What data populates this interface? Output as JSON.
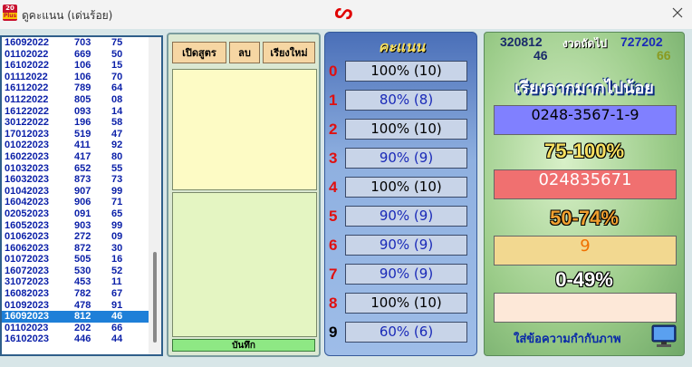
{
  "window": {
    "title": "ดูคะแนน (เด่นร้อย)",
    "app_icon_top": "20",
    "app_icon_bottom": "Plus"
  },
  "list": {
    "rows": [
      [
        "16092022",
        "703",
        "75"
      ],
      [
        "01102022",
        "669",
        "50"
      ],
      [
        "16102022",
        "106",
        "15"
      ],
      [
        "01112022",
        "106",
        "70"
      ],
      [
        "16112022",
        "789",
        "64"
      ],
      [
        "01122022",
        "805",
        "08"
      ],
      [
        "16122022",
        "093",
        "14"
      ],
      [
        "30122022",
        "196",
        "58"
      ],
      [
        "17012023",
        "519",
        "47"
      ],
      [
        "01022023",
        "411",
        "92"
      ],
      [
        "16022023",
        "417",
        "80"
      ],
      [
        "01032023",
        "652",
        "55"
      ],
      [
        "16032023",
        "873",
        "73"
      ],
      [
        "01042023",
        "907",
        "99"
      ],
      [
        "16042023",
        "906",
        "71"
      ],
      [
        "02052023",
        "091",
        "65"
      ],
      [
        "16052023",
        "903",
        "99"
      ],
      [
        "01062023",
        "272",
        "09"
      ],
      [
        "16062023",
        "872",
        "30"
      ],
      [
        "01072023",
        "505",
        "16"
      ],
      [
        "16072023",
        "530",
        "52"
      ],
      [
        "31072023",
        "453",
        "11"
      ],
      [
        "16082023",
        "782",
        "67"
      ],
      [
        "01092023",
        "478",
        "91"
      ],
      [
        "16092023",
        "812",
        "46"
      ],
      [
        "01102023",
        "202",
        "66"
      ],
      [
        "16102023",
        "446",
        "44"
      ]
    ],
    "selected_index": 24
  },
  "formula": {
    "open_label": "เปิดสูตร",
    "delete_label": "ลบ",
    "sort_new_label": "เรียงใหม่",
    "save_label": "บันทึก"
  },
  "scores": {
    "header": "คะแนน",
    "rows": [
      {
        "digit": "0",
        "text": "100% (10)",
        "color": "red"
      },
      {
        "digit": "1",
        "text": "80% (8)",
        "color": "red"
      },
      {
        "digit": "2",
        "text": "100% (10)",
        "color": "red"
      },
      {
        "digit": "3",
        "text": "90% (9)",
        "color": "red"
      },
      {
        "digit": "4",
        "text": "100% (10)",
        "color": "red"
      },
      {
        "digit": "5",
        "text": "90% (9)",
        "color": "red"
      },
      {
        "digit": "6",
        "text": "90% (9)",
        "color": "red"
      },
      {
        "digit": "7",
        "text": "90% (9)",
        "color": "red"
      },
      {
        "digit": "8",
        "text": "100% (10)",
        "color": "red"
      },
      {
        "digit": "9",
        "text": "60% (6)",
        "color": "black"
      }
    ]
  },
  "summary": {
    "current_top": "320812",
    "current_bottom": "46",
    "next_label": "งวดถัดไป",
    "next_top": "727202",
    "next_bottom": "66",
    "sort_title": "เรียงจากมากไปน้อย",
    "sorted_all": "0248-3567-1-9",
    "range_high_label": "75-100%",
    "range_high_value": "024835671",
    "range_mid_label": "50-74%",
    "range_mid_value": "9",
    "range_low_label": "0-49%",
    "range_low_value": "",
    "footer": "ใส่ข้อความกำกับภาพ"
  },
  "colors": {
    "accent_red": "#e01010",
    "list_text": "#0a1fa8",
    "selected_row": "#1e7fd8",
    "high_box": "#8080ff",
    "mid_box": "#f07070",
    "low_box": "#f2d890",
    "empty_box": "#fde8d8",
    "range_high_color": "#f8e060",
    "range_mid_color": "#f0a030",
    "range_low_color": "#ffffff"
  },
  "icons": [
    "app-icon",
    "close-icon",
    "monitor-icon"
  ]
}
